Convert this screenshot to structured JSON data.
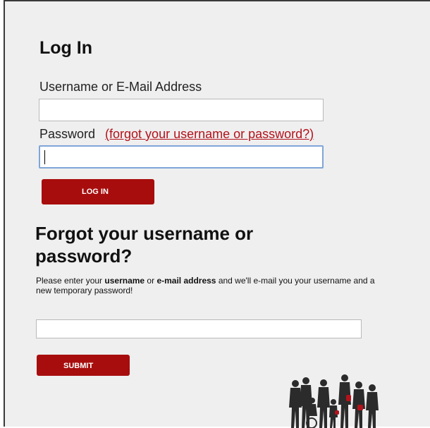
{
  "login": {
    "title": "Log In",
    "username_label": "Username or E-Mail Address",
    "username_value": "",
    "password_label": "Password",
    "forgot_link": "(forgot your username or password?)",
    "password_value": "",
    "button_label": "LOG IN"
  },
  "recover": {
    "title": "Forgot your username or password?",
    "instructions": {
      "part1": "Please enter your ",
      "bold1": "username",
      "part2": " or ",
      "bold2": "e-mail address",
      "part3": " and we'll e-mail you your username and a new temporary password!"
    },
    "input_value": "",
    "button_label": "SUBMIT"
  },
  "colors": {
    "accent": "#a80d0d",
    "link": "#b3121b",
    "focus_border": "#7fa5d8",
    "background": "#efefef"
  },
  "icons": {
    "decoration": "family-silhouette-icon"
  }
}
